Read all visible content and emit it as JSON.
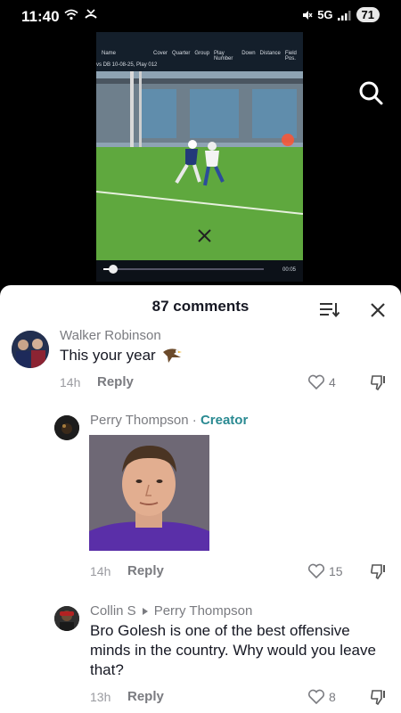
{
  "status": {
    "time": "11:40",
    "network": "5G",
    "battery": "71",
    "icons": [
      "wifi-icon",
      "missed-call-icon",
      "mute-icon",
      "signal-icon"
    ]
  },
  "video": {
    "header_name": "Name",
    "header_columns": [
      "Cover",
      "Quarter",
      "Group",
      "Play Number",
      "Down",
      "Distance",
      "Field Pos."
    ],
    "header_subtitle": "vs DB 10-08-25, Play 012",
    "timestamp": "00:05",
    "progress": 0.06
  },
  "comments_panel": {
    "title": "87 comments",
    "sort_icon": "sort-icon",
    "close_icon": "close-icon"
  },
  "comments": [
    {
      "author": "Walker Robinson",
      "text": "This your year",
      "emoji": "eagle-emoji",
      "time": "14h",
      "reply": "Reply",
      "likes": "4"
    },
    {
      "author": "Perry Thompson",
      "badge": "Creator",
      "separator": "·",
      "image": "portrait-photo",
      "time": "14h",
      "reply": "Reply",
      "likes": "15"
    },
    {
      "author": "Collin S",
      "reply_to": "Perry Thompson",
      "text": "Bro Golesh is one of the best offensive minds in the country. Why would you leave that?",
      "time": "13h",
      "reply": "Reply",
      "likes": "8"
    }
  ],
  "colors": {
    "creator": "#2a8a92",
    "text_primary": "#161823",
    "text_secondary": "#7a7b80"
  }
}
